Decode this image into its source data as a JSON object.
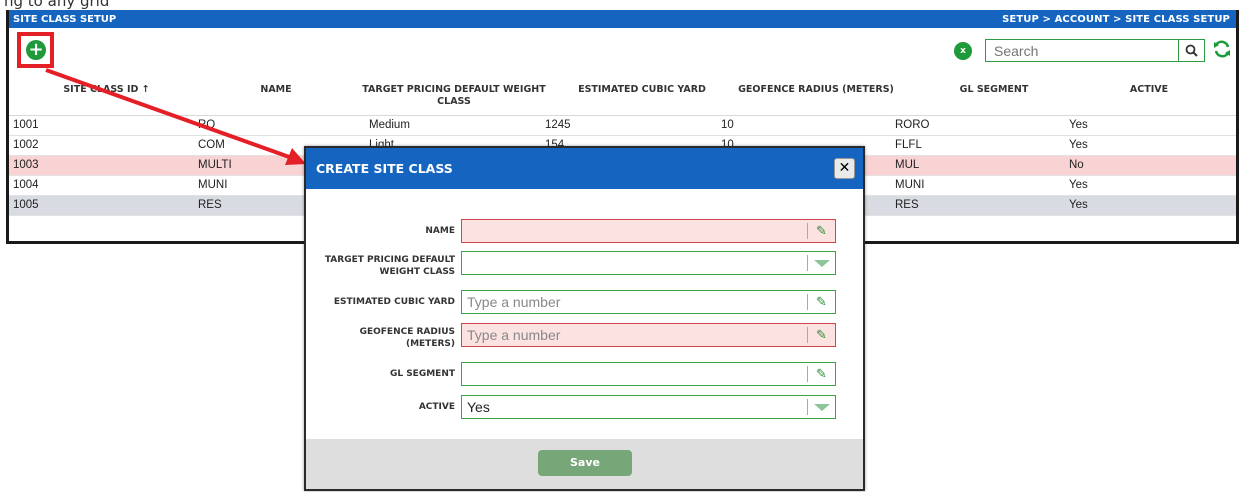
{
  "top_text": "ng to any grid",
  "header": {
    "title": "SITE CLASS SETUP",
    "breadcrumb": "SETUP  >  ACCOUNT  >  SITE CLASS SETUP"
  },
  "toolbar": {
    "add_icon": "plus-circle-icon",
    "excel_icon": "excel-export-icon",
    "excel_glyph": "x",
    "search_placeholder": "Search",
    "search_icon": "magnifier-icon",
    "refresh_icon": "refresh-icon"
  },
  "grid": {
    "columns": [
      {
        "label": "SITE CLASS ID ↑"
      },
      {
        "label": "NAME"
      },
      {
        "label": "TARGET PRICING DEFAULT WEIGHT CLASS"
      },
      {
        "label": "ESTIMATED CUBIC YARD"
      },
      {
        "label": "GEOFENCE RADIUS (METERS)"
      },
      {
        "label": "GL SEGMENT"
      },
      {
        "label": "ACTIVE"
      }
    ],
    "rows": [
      {
        "id": "1001",
        "name": "RO",
        "weight": "Medium",
        "cubic": "1245",
        "radius": "10",
        "gl": "RORO",
        "active": "Yes"
      },
      {
        "id": "1002",
        "name": "COM",
        "weight": "Light",
        "cubic": "154",
        "radius": "10",
        "gl": "FLFL",
        "active": "Yes"
      },
      {
        "id": "1003",
        "name": "MULTI",
        "weight": "",
        "cubic": "",
        "radius": "",
        "gl": "MUL",
        "active": "No"
      },
      {
        "id": "1004",
        "name": "MUNI",
        "weight": "",
        "cubic": "",
        "radius": "",
        "gl": "MUNI",
        "active": "Yes"
      },
      {
        "id": "1005",
        "name": "RES",
        "weight": "",
        "cubic": "",
        "radius": "",
        "gl": "RES",
        "active": "Yes"
      }
    ]
  },
  "modal": {
    "title": "CREATE SITE CLASS",
    "close_glyph": "✕",
    "fields": [
      {
        "label": "NAME",
        "value": "",
        "placeholder": ""
      },
      {
        "label": "TARGET PRICING DEFAULT WEIGHT CLASS",
        "value": "",
        "placeholder": ""
      },
      {
        "label": "ESTIMATED CUBIC YARD",
        "value": "",
        "placeholder": "Type a number"
      },
      {
        "label": "GEOFENCE RADIUS (METERS)",
        "value": "",
        "placeholder": "Type a number"
      },
      {
        "label": "GL SEGMENT",
        "value": "",
        "placeholder": ""
      },
      {
        "label": "ACTIVE",
        "value": "Yes",
        "placeholder": ""
      }
    ],
    "save_label": "Save"
  },
  "colors": {
    "header_blue": "#1565c0",
    "accent_green": "#1f9a3a",
    "invalid_pink": "#fde2e2",
    "annotation_red": "#e41f26"
  }
}
